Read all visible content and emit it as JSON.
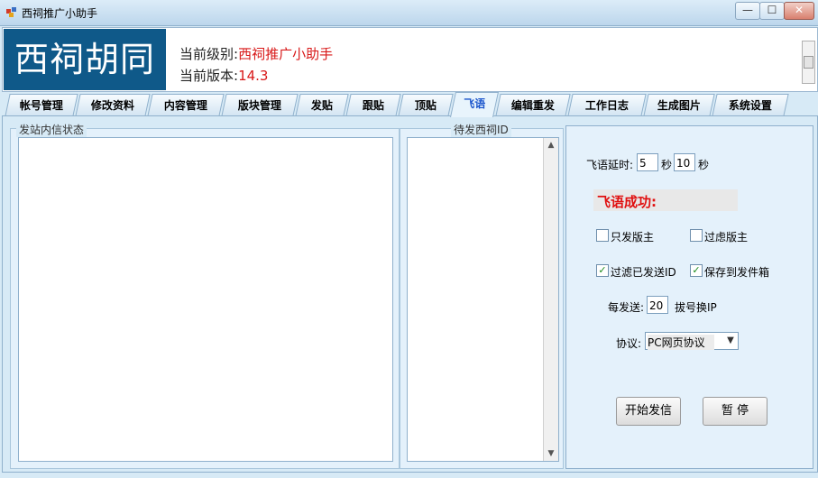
{
  "window": {
    "title": "西祠推广小助手",
    "controls": {
      "minimize": "—",
      "maximize": "☐",
      "close": "✕"
    }
  },
  "header": {
    "logo_text": "西祠胡同",
    "level_label": "当前级别:",
    "level_value": "西祠推广小助手",
    "version_label": "当前版本:",
    "version_value": "14.3"
  },
  "tabs": [
    {
      "label": "帐号管理"
    },
    {
      "label": "修改资料"
    },
    {
      "label": "内容管理"
    },
    {
      "label": "版块管理"
    },
    {
      "label": "发贴"
    },
    {
      "label": "跟贴"
    },
    {
      "label": "顶贴"
    },
    {
      "label": "飞语"
    },
    {
      "label": "编辑重发"
    },
    {
      "label": "工作日志"
    },
    {
      "label": "生成图片"
    },
    {
      "label": "系统设置"
    }
  ],
  "active_tab": "飞语",
  "left_panel": {
    "title": "发站内信状态"
  },
  "middle_panel": {
    "title": "待发西祠ID"
  },
  "settings": {
    "delay_label": "飞语延时:",
    "delay_from": "5",
    "sec1": "秒",
    "delay_to": "10",
    "sec2": "秒",
    "status_text": "飞语成功:",
    "only_moderator": {
      "label": "只发版主",
      "checked": false
    },
    "filter_moderator": {
      "label": "过虑版主",
      "checked": false
    },
    "filter_sent_id": {
      "label": "过滤已发送ID",
      "checked": true
    },
    "save_outbox": {
      "label": "保存到发件箱",
      "checked": true
    },
    "per_send_label": "每发送:",
    "per_send_value": "20",
    "dial_label": "拔号换IP",
    "protocol_label": "协议:",
    "protocol_value": "PC网页协议",
    "start_button": "开始发信",
    "pause_button": "暂 停"
  },
  "colors": {
    "logo_bg": "#0f5989",
    "accent_red": "#d81818",
    "active_tab_text": "#1a55cc",
    "panel_bg": "#e4f1fb"
  }
}
